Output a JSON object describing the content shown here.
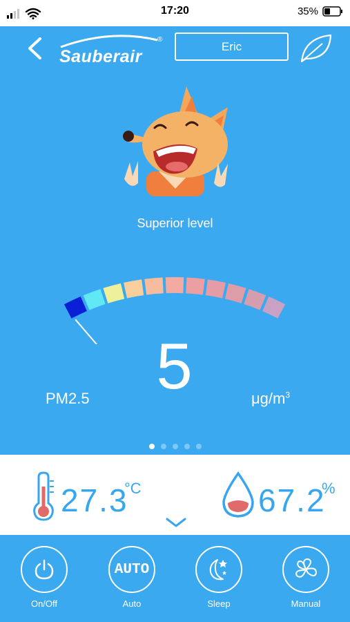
{
  "status": {
    "time": "17:20",
    "battery_pct": "35%",
    "icons": [
      "signal-icon",
      "wifi-icon",
      "battery-icon"
    ]
  },
  "header": {
    "brand": "Sauberair",
    "brand_mark": "®",
    "device_name": "Eric",
    "icons": [
      "back-icon",
      "leaf-icon"
    ]
  },
  "air": {
    "level_text": "Superior level",
    "pm_label": "PM2.5",
    "pm_value": "5",
    "unit": "μg/m",
    "unit_sup": "3",
    "gauge_segments": 11,
    "gauge_value_fraction": 0.02
  },
  "pager": {
    "count": 5,
    "active": 0
  },
  "env": {
    "temperature": "27.3",
    "temp_unit": "°C",
    "humidity": "67.2",
    "hum_unit": "%"
  },
  "controls": [
    {
      "label": "On/Off",
      "icon": "power-icon"
    },
    {
      "label": "Auto",
      "icon": "auto-icon",
      "text": "AUTO"
    },
    {
      "label": "Sleep",
      "icon": "moon-stars-icon"
    },
    {
      "label": "Manual",
      "icon": "fan-icon"
    }
  ],
  "colors": {
    "primary": "#3aa9f0",
    "accent_text": "#38a6ef",
    "gauge_start": "#0a1fd6",
    "gauge_end": "#c49ecb"
  }
}
